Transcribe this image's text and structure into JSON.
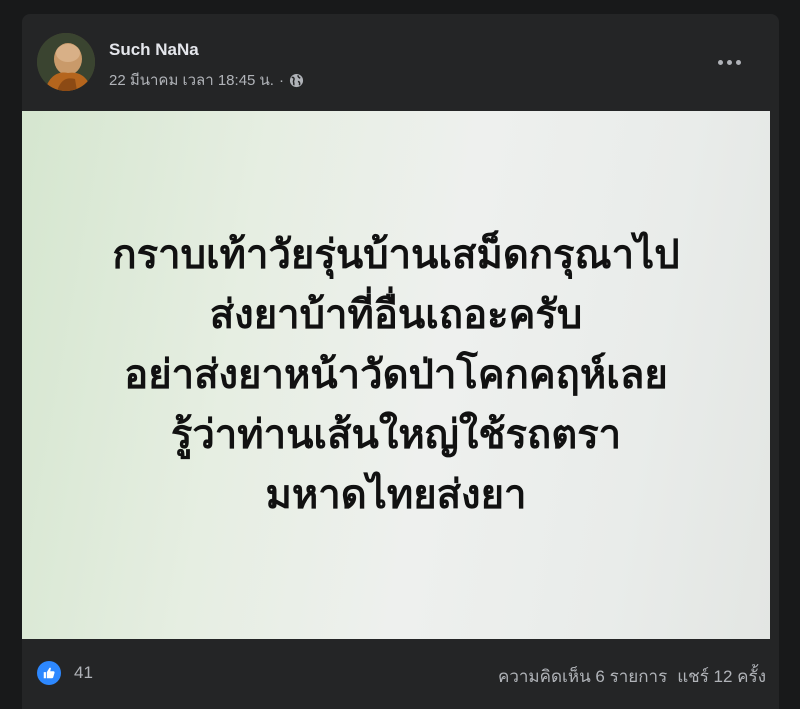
{
  "post": {
    "author": "Such NaNa",
    "timestamp": "22 มีนาคม เวลา 18:45 น.",
    "separator": "·",
    "privacy_icon": "globe-icon",
    "more_icon": "more-options-icon",
    "image_text": [
      "กราบเท้าวัยรุ่นบ้านเสม็ดกรุณาไป",
      "ส่งยาบ้าที่อื่นเถอะครับ",
      "อย่าส่งยาหน้าวัดป่าโคกคฤห์เลย",
      "รู้ว่าท่านเส้นใหญ่ใช้รถตรา",
      "มหาดไทยส่งยา"
    ]
  },
  "reactions": {
    "icon": "like-icon",
    "count": "41",
    "comments": "ความคิดเห็น 6 รายการ",
    "shares": "แชร์ 12 ครั้ง"
  },
  "colors": {
    "background": "#18191a",
    "card": "#242526",
    "primary_text": "#e4e6eb",
    "secondary_text": "#b0b3b8",
    "like_blue": "#2d88ff"
  }
}
